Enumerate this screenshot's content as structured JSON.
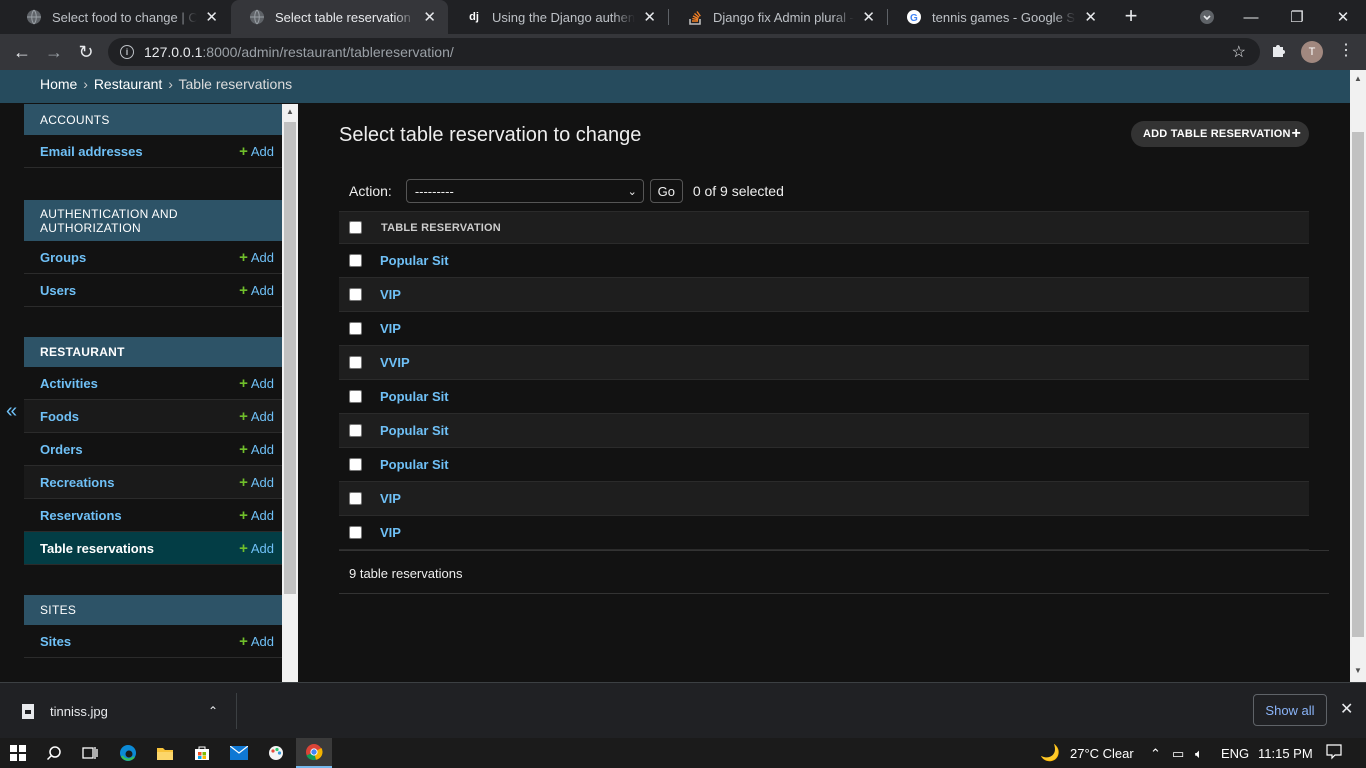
{
  "browser": {
    "tabs": [
      {
        "title": "Select food to change | Coral",
        "favicon": "globe-icon",
        "active": false
      },
      {
        "title": "Select table reservation to change",
        "favicon": "globe-icon",
        "active": true
      },
      {
        "title": "Using the Django authentication",
        "favicon": "django-icon",
        "favicon_text": "dj",
        "active": false
      },
      {
        "title": "Django fix Admin plural - Stack",
        "favicon": "stackoverflow-icon",
        "active": false
      },
      {
        "title": "tennis games - Google Search",
        "favicon": "google-icon",
        "active": false
      }
    ],
    "url_host": "127.0.0.1",
    "url_path": ":8000/admin/restaurant/tablereservation/",
    "profile_initial": "T"
  },
  "breadcrumbs": {
    "home": "Home",
    "app": "Restaurant",
    "current": "Table reservations",
    "separator": "›"
  },
  "sidebar": {
    "toggle": "«",
    "add_label": "Add",
    "modules": [
      {
        "caption": "ACCOUNTS",
        "items": [
          {
            "label": "Email addresses"
          }
        ]
      },
      {
        "caption": "AUTHENTICATION AND AUTHORIZATION",
        "items": [
          {
            "label": "Groups"
          },
          {
            "label": "Users"
          }
        ]
      },
      {
        "caption": "RESTAURANT",
        "items": [
          {
            "label": "Activities"
          },
          {
            "label": "Foods"
          },
          {
            "label": "Orders"
          },
          {
            "label": "Recreations"
          },
          {
            "label": "Reservations"
          },
          {
            "label": "Table reservations",
            "current": true
          }
        ]
      },
      {
        "caption": "SITES",
        "items": [
          {
            "label": "Sites"
          }
        ]
      }
    ]
  },
  "content": {
    "title": "Select table reservation to change",
    "add_button": "ADD TABLE RESERVATION",
    "action_label": "Action:",
    "action_selected": "---------",
    "go_label": "Go",
    "selection_counter": "0 of 9 selected",
    "column_header": "TABLE RESERVATION",
    "rows": [
      "Popular Sit",
      "VIP",
      "VIP",
      "VVIP",
      "Popular Sit",
      "Popular Sit",
      "Popular Sit",
      "VIP",
      "VIP"
    ],
    "paginator": "9 table reservations"
  },
  "downloads": {
    "file_name": "tinniss.jpg",
    "show_all": "Show all"
  },
  "taskbar": {
    "weather": "27°C  Clear",
    "language": "ENG",
    "time": "11:15 PM"
  },
  "colors": {
    "link": "#6fc0f6",
    "header": "#264b5d",
    "module_caption": "#2d5367",
    "selected_row": "#033d45",
    "add_plus": "#70bf2b"
  }
}
